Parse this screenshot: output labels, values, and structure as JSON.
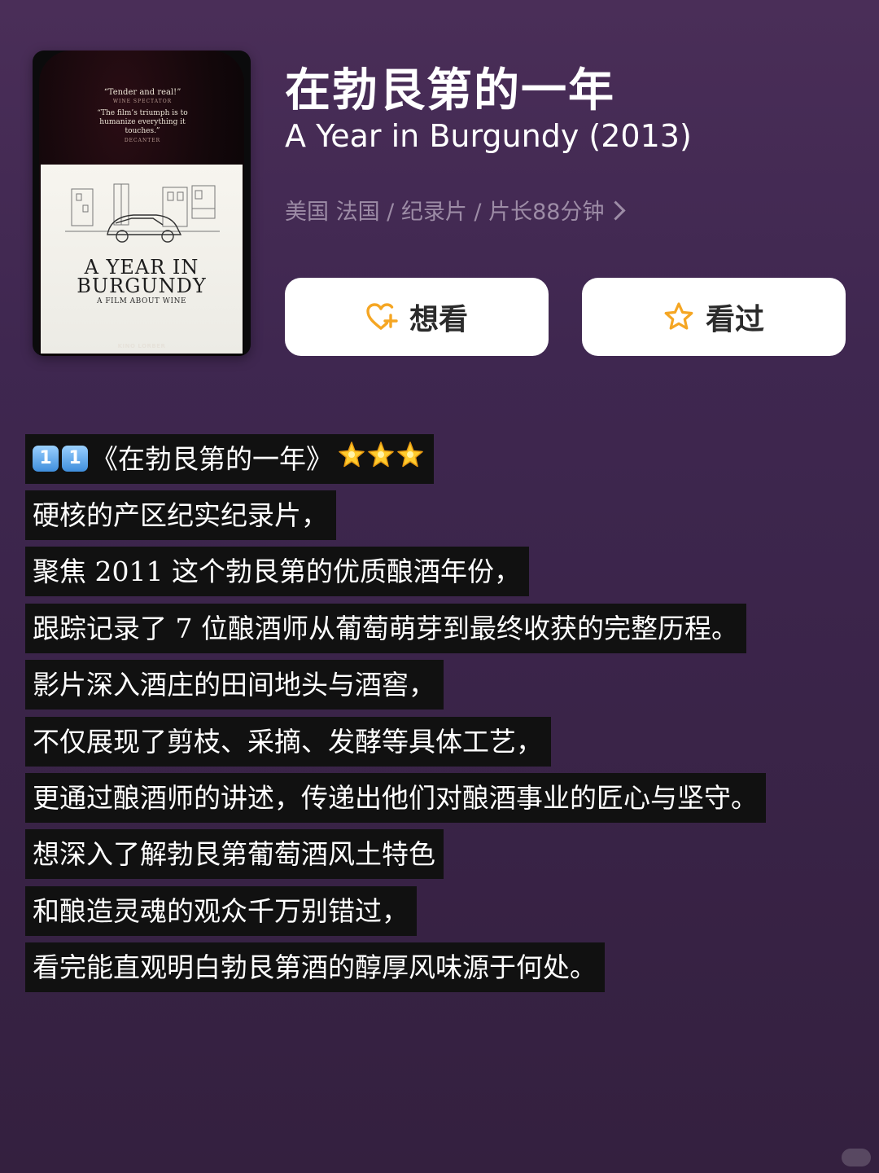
{
  "movie": {
    "title_cn": "在勃艮第的一年",
    "title_en": "A Year in Burgundy (2013)",
    "meta": "美国 法国 / 纪录片 / 片长88分钟",
    "poster": {
      "quote1": "“Tender and real!”",
      "quote1_source": "WINE SPECTATOR",
      "quote2": "“The film’s triumph is to humanize everything it touches.”",
      "quote2_source": "DECANTER",
      "title_line1": "A YEAR IN",
      "title_line2": "BURGUNDY",
      "tagline": "A FILM ABOUT WINE",
      "logo": "KINO LORBER"
    }
  },
  "buttons": {
    "want": "想看",
    "seen": "看过"
  },
  "review": {
    "badge": [
      "1",
      "1"
    ],
    "heading": "《在勃艮第的一年》",
    "stars": 3,
    "lines": [
      "硬核的产区纪实纪录片，",
      "聚焦 2011 这个勃艮第的优质酿酒年份，",
      "跟踪记录了 7 位酿酒师从葡萄萌芽到最终收获的完整历程。",
      "影片深入酒庄的田间地头与酒窖，",
      "不仅展现了剪枝、采摘、发酵等具体工艺，",
      "更通过酿酒师的讲述，传递出他们对酿酒事业的匠心与坚守。",
      "想深入了解勃艮第葡萄酒风土特色",
      "和酿造灵魂的观众千万别错过，",
      "看完能直观明白勃艮第酒的醇厚风味源于何处。"
    ]
  },
  "colors": {
    "background_top": "#4a2e58",
    "background_bottom": "#34203f",
    "meta_text": "#9d8ca6",
    "button_icon": "#f5a623",
    "text_bg": "#111111"
  }
}
